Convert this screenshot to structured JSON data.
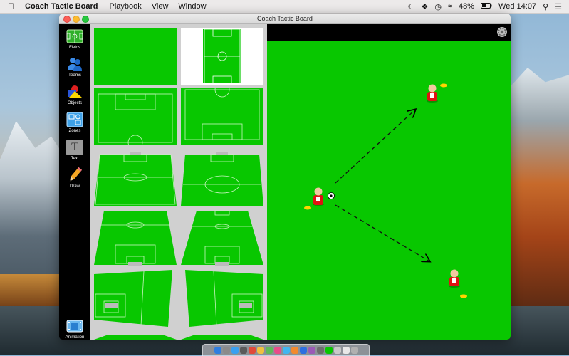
{
  "menubar": {
    "app_name": "Coach Tactic Board",
    "menus": [
      "Playbook",
      "View",
      "Window"
    ],
    "battery": "48%",
    "clock": "Wed 14:07"
  },
  "window": {
    "title": "Coach Tactic Board"
  },
  "toolbar": {
    "items": [
      {
        "label": "Fields",
        "icon": "field-icon"
      },
      {
        "label": "Teams",
        "icon": "teams-icon"
      },
      {
        "label": "Objects",
        "icon": "objects-icon"
      },
      {
        "label": "Zones",
        "icon": "zones-icon"
      },
      {
        "label": "Text",
        "icon": "text-icon"
      },
      {
        "label": "Draw",
        "icon": "pencil-icon"
      }
    ],
    "animation_label": "Animation"
  },
  "text_tool_glyph": "T",
  "colors": {
    "field_green": "#08c700",
    "line_white": "#ffffff",
    "player_red": "#e01212",
    "cone_yellow": "#ffd400"
  }
}
